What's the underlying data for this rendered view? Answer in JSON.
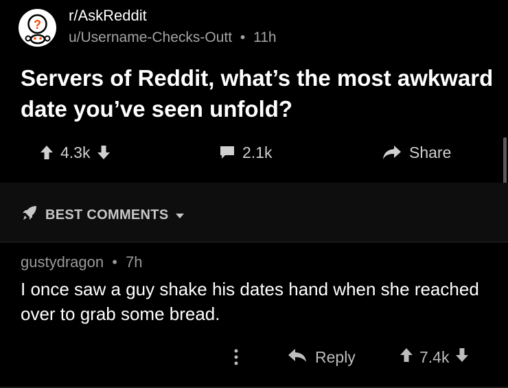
{
  "post": {
    "subreddit": "r/AskReddit",
    "author": "u/Username-Checks-Outt",
    "separator": "•",
    "age": "11h",
    "title": "Servers of Reddit, what’s the most awkward date you’ve seen unfold?",
    "score": "4.3k",
    "comment_count": "2.1k",
    "share_label": "Share"
  },
  "comments_section": {
    "sort_label": "BEST COMMENTS"
  },
  "comment": {
    "author": "gustydragon",
    "separator": "•",
    "age": "7h",
    "body": "I once saw a guy shake his dates hand when she reached over to grab some bread.",
    "reply_label": "Reply",
    "score": "7.4k"
  },
  "colors": {
    "background": "#000000",
    "text": "#ffffff",
    "muted": "#9a9a9a"
  }
}
